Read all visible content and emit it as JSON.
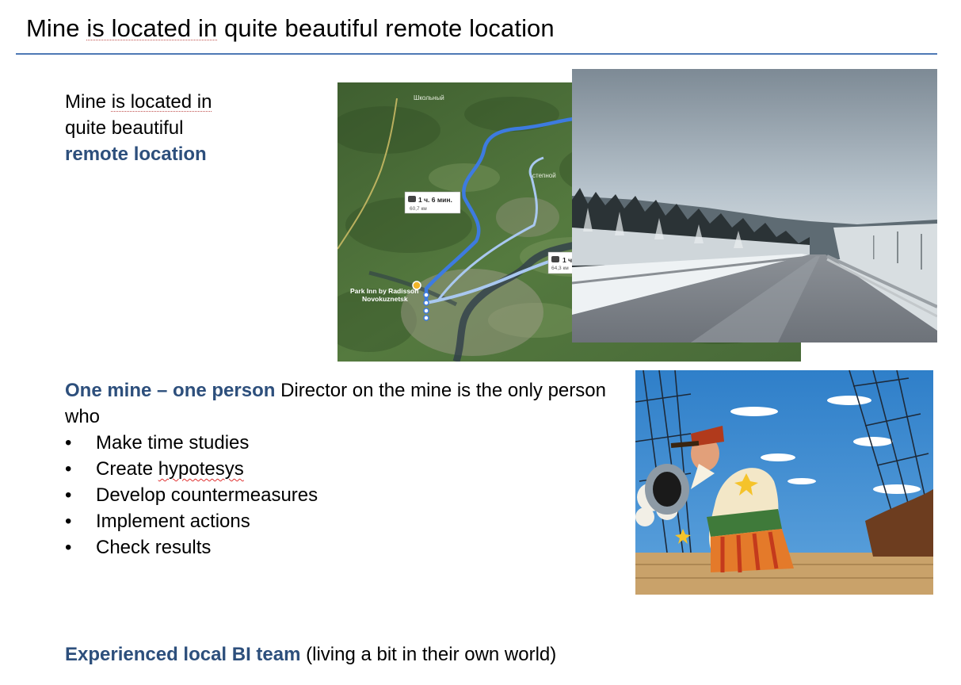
{
  "title": {
    "part1": "Mine ",
    "underlined": "is located in",
    "part2": " quite beautiful remote location"
  },
  "intro": {
    "line1_part1": "Mine ",
    "line1_underlined": "is located in",
    "line2": "quite beautiful",
    "line3": "remote location"
  },
  "map": {
    "place_top": "Школьный",
    "place_right": "степной",
    "route1_time": "1 ч. 6 мин.",
    "route1_dist": "60,7 км",
    "route2_time": "1 ч",
    "route2_dist": "64,3 км",
    "hotel_line1": "Park Inn by Radisson",
    "hotel_line2": "Novokuznetsk"
  },
  "role": {
    "heading": "One mine – one person",
    "text": " Director on the mine is the only person who",
    "bullet_char": "•",
    "bullets": [
      "Make time studies",
      "Create ",
      "Develop countermeasures",
      "Implement actions",
      "Check results"
    ],
    "bullet2_misspelled": "hypotesys"
  },
  "team": {
    "heading": "Experienced local BI team",
    "text": " (living a bit in their own world)"
  },
  "colors": {
    "accent": "#2d4f7c",
    "rule": "#4e79b5",
    "route_primary": "#3d7be0",
    "route_alt": "#a9c8f0"
  }
}
